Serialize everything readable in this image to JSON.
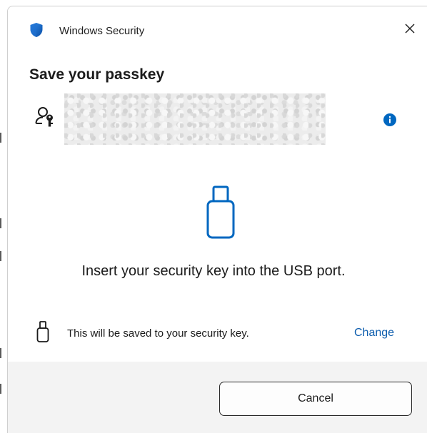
{
  "window": {
    "app_title": "Windows Security",
    "close_icon": "close-icon",
    "app_icon": "windows-security-shield-icon"
  },
  "main": {
    "heading": "Save your passkey",
    "account_icon": "person-key-icon",
    "info_icon": "info-icon",
    "device_icon": "usb-key-icon",
    "instruction": "Insert your security key into the USB port.",
    "save_note": "This will be saved to your security key.",
    "change_label": "Change"
  },
  "footer": {
    "cancel_label": "Cancel"
  },
  "colors": {
    "accent": "#0067c0",
    "link": "#0b5cad",
    "footer_bg": "#f3f3f3"
  }
}
